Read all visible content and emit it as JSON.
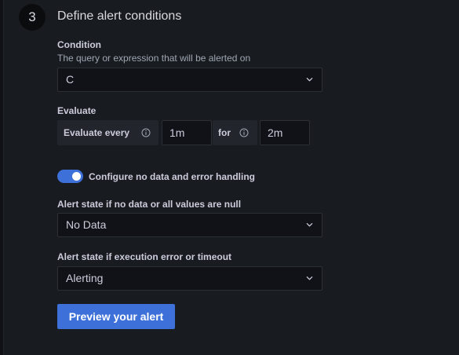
{
  "step": {
    "number": "3",
    "title": "Define alert conditions"
  },
  "condition": {
    "label": "Condition",
    "description": "The query or expression that will be alerted on",
    "value": "C"
  },
  "evaluate": {
    "label": "Evaluate",
    "every_label": "Evaluate every",
    "every_value": "1m",
    "for_label": "for",
    "for_value": "2m"
  },
  "no_data_toggle": {
    "label": "Configure no data and error handling",
    "enabled": true
  },
  "no_data_state": {
    "label": "Alert state if no data or all values are null",
    "value": "No Data"
  },
  "error_state": {
    "label": "Alert state if execution error or timeout",
    "value": "Alerting"
  },
  "preview_button": {
    "label": "Preview your alert"
  },
  "colors": {
    "accent": "#3d71d9",
    "panel_bg": "#181b1f",
    "input_bg": "#111217"
  },
  "icons": {
    "dropdown": "chevron-down-icon",
    "info": "info-circle-icon"
  }
}
